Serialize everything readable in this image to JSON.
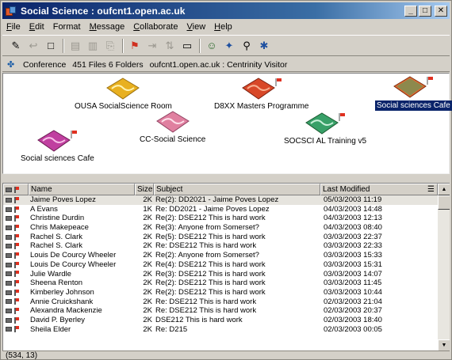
{
  "window": {
    "title": "Social Science : oufcnt1.open.ac.uk",
    "minimize": "_",
    "maximize": "□",
    "close": "✕"
  },
  "menu": {
    "items": [
      {
        "label": "File",
        "underline": "F",
        "rest": "ile"
      },
      {
        "label": "Edit",
        "underline": "E",
        "rest": "dit"
      },
      {
        "label": "Format",
        "underline": "",
        "rest": "Format"
      },
      {
        "label": "Message",
        "underline": "M",
        "rest": "essage"
      },
      {
        "label": "Collaborate",
        "underline": "C",
        "rest": "ollaborate"
      },
      {
        "label": "View",
        "underline": "V",
        "rest": "iew"
      },
      {
        "label": "Help",
        "underline": "H",
        "rest": "elp"
      }
    ]
  },
  "toolbar": {
    "icons": [
      "new-message-icon",
      "reply-icon",
      "new-document-icon",
      "delete-icon",
      "cut-icon",
      "copy-icon",
      "flag-icon",
      "move-icon",
      "sort-icon",
      "window-icon",
      "users-icon",
      "conference-icon",
      "search-icon",
      "settings-icon"
    ]
  },
  "info": {
    "segments": [
      "Conference",
      "451 Files 6 Folders",
      "oufcnt1.open.ac.uk : Centrinity Visitor"
    ]
  },
  "conferences": [
    {
      "label": "OUSA SocialScience Room",
      "color": "#e8b020",
      "selected": false,
      "flag": false
    },
    {
      "label": "D8XX Masters Programme",
      "color": "#d84828",
      "selected": false,
      "flag": true
    },
    {
      "label": "Social sciences Cafe",
      "color": "#e86830",
      "selected": true,
      "flag": true
    },
    {
      "label": "CC-Social Science",
      "color": "#e080a0",
      "selected": false,
      "flag": false
    },
    {
      "label": "SOCSCI AL Training v5",
      "color": "#38a068",
      "selected": false,
      "flag": true
    },
    {
      "label": "Social sciences Cafe",
      "color": "#c040a0",
      "selected": false,
      "flag": true
    }
  ],
  "list": {
    "columns": {
      "name": "Name",
      "size": "Size",
      "subject": "Subject",
      "modified": "Last Modified"
    },
    "rows": [
      {
        "name": "Jaime Poves Lopez",
        "size": "2K",
        "subject": "Re(2): DD2021 - Jaime Poves Lopez",
        "modified": "05/03/2003  11:19"
      },
      {
        "name": "A Evans",
        "size": "1K",
        "subject": "Re: DD2021 - Jaime Poves Lopez",
        "modified": "04/03/2003  14:48"
      },
      {
        "name": "Christine Durdin",
        "size": "2K",
        "subject": "Re(2): DSE212 This is hard work",
        "modified": "04/03/2003  12:13"
      },
      {
        "name": "Chris Makepeace",
        "size": "2K",
        "subject": "Re(3): Anyone from Somerset?",
        "modified": "04/03/2003  08:40"
      },
      {
        "name": "Rachel S. Clark",
        "size": "2K",
        "subject": "Re(5): DSE212 This is hard work",
        "modified": "03/03/2003  22:37"
      },
      {
        "name": "Rachel S. Clark",
        "size": "2K",
        "subject": "Re: DSE212 This is hard work",
        "modified": "03/03/2003  22:33"
      },
      {
        "name": "Louis De Courcy Wheeler",
        "size": "2K",
        "subject": "Re(2): Anyone from Somerset?",
        "modified": "03/03/2003  15:33"
      },
      {
        "name": "Louis De Courcy Wheeler",
        "size": "2K",
        "subject": "Re(4): DSE212 This is hard work",
        "modified": "03/03/2003  15:31"
      },
      {
        "name": "Julie Wardle",
        "size": "2K",
        "subject": "Re(3): DSE212 This is hard work",
        "modified": "03/03/2003  14:07"
      },
      {
        "name": "Sheena Renton",
        "size": "2K",
        "subject": "Re(2): DSE212 This is hard work",
        "modified": "03/03/2003  11:45"
      },
      {
        "name": "Kimberley Johnson",
        "size": "2K",
        "subject": "Re(2): DSE212 This is hard work",
        "modified": "03/03/2003  10:44"
      },
      {
        "name": "Annie Cruickshank",
        "size": "2K",
        "subject": "Re: DSE212 This is hard work",
        "modified": "02/03/2003  21:04"
      },
      {
        "name": "Alexandra Mackenzie",
        "size": "2K",
        "subject": "Re: DSE212 This is hard work",
        "modified": "02/03/2003  20:37"
      },
      {
        "name": "David P. Byerley",
        "size": "2K",
        "subject": "DSE212 This is hard work",
        "modified": "02/03/2003  18:40"
      },
      {
        "name": "Sheila Elder",
        "size": "2K",
        "subject": "Re: D215",
        "modified": "02/03/2003  00:05"
      }
    ]
  },
  "status": {
    "coords": "(534, 13)"
  }
}
